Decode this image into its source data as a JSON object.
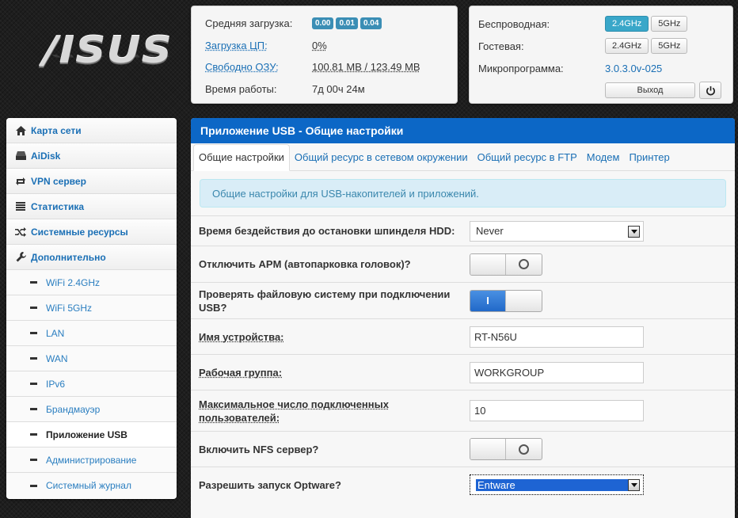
{
  "logo": {
    "text": "/ISUS"
  },
  "status": {
    "load_label": "Средняя загрузка:",
    "load_values": [
      "0.00",
      "0.01",
      "0.04"
    ],
    "cpu_label": "Загрузка ЦП:",
    "cpu_value": "0%",
    "ram_label": "Свободно ОЗУ:",
    "ram_value": "100.81 MB / 123.49 MB",
    "uptime_label": "Время работы:",
    "uptime_value": "7д 00ч 24м"
  },
  "firmware": {
    "wireless_label": "Беспроводная:",
    "guest_label": "Гостевая:",
    "band_24": "2.4GHz",
    "band_5": "5GHz",
    "fw_label": "Микропрограмма:",
    "fw_version": "3.0.3.0v-025",
    "logout": "Выход"
  },
  "sidebar": {
    "items": [
      {
        "label": "Карта сети",
        "icon": "home-icon"
      },
      {
        "label": "AiDisk",
        "icon": "disk-icon"
      },
      {
        "label": "VPN сервер",
        "icon": "vpn-icon"
      },
      {
        "label": "Статистика",
        "icon": "list-icon"
      },
      {
        "label": "Системные ресурсы",
        "icon": "shuffle-icon"
      },
      {
        "label": "Дополнительно",
        "icon": "wrench-icon"
      }
    ],
    "subitems": [
      {
        "label": "WiFi 2.4GHz"
      },
      {
        "label": "WiFi 5GHz"
      },
      {
        "label": "LAN"
      },
      {
        "label": "WAN"
      },
      {
        "label": "IPv6"
      },
      {
        "label": "Брандмауэр"
      },
      {
        "label": "Приложение USB"
      },
      {
        "label": "Администрирование"
      },
      {
        "label": "Системный журнал"
      }
    ]
  },
  "main": {
    "title": "Приложение USB - Общие настройки",
    "tabs": [
      "Общие настройки",
      "Общий ресурс в сетевом окружении",
      "Общий ресурс в FTP",
      "Модем",
      "Принтер"
    ],
    "info": "Общие настройки для USB-накопителей и приложений.",
    "rows": {
      "hdd_idle_label": "Время бездействия до остановки шпинделя HDD:",
      "hdd_idle_value": "Never",
      "apm_label": "Отключить APM (автопарковка головок)?",
      "fscheck_label_1": "Проверять файловую систему при подключении",
      "fscheck_label_2": "USB?",
      "toggle_on_text": "I",
      "device_name_label": "Имя устройства:",
      "device_name_value": "RT-N56U",
      "workgroup_label": "Рабочая группа:",
      "workgroup_value": "WORKGROUP",
      "max_users_label_1": "Максимальное число подключенных",
      "max_users_label_2": "пользователей:",
      "max_users_value": "10",
      "nfs_label": "Включить NFS сервер?",
      "optware_label": "Разрешить запуск Optware?",
      "optware_value": "Entware"
    }
  },
  "colors": {
    "header_blue": "#0c67c6",
    "link_blue": "#1a6fb5",
    "badge": "#3b8eb5",
    "active_band": "#39a7c9"
  }
}
